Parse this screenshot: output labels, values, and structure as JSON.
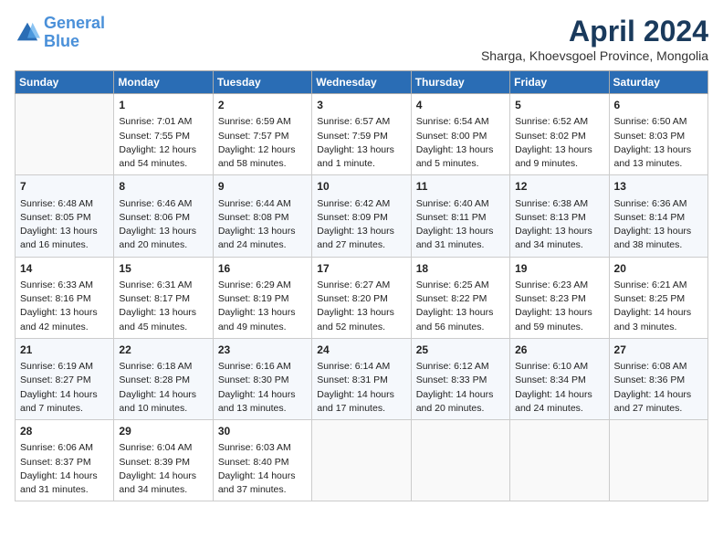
{
  "header": {
    "logo_line1": "General",
    "logo_line2": "Blue",
    "month_year": "April 2024",
    "location": "Sharga, Khoevsgoel Province, Mongolia"
  },
  "weekdays": [
    "Sunday",
    "Monday",
    "Tuesday",
    "Wednesday",
    "Thursday",
    "Friday",
    "Saturday"
  ],
  "weeks": [
    [
      {
        "day": "",
        "sunrise": "",
        "sunset": "",
        "daylight": ""
      },
      {
        "day": "1",
        "sunrise": "Sunrise: 7:01 AM",
        "sunset": "Sunset: 7:55 PM",
        "daylight": "Daylight: 12 hours and 54 minutes."
      },
      {
        "day": "2",
        "sunrise": "Sunrise: 6:59 AM",
        "sunset": "Sunset: 7:57 PM",
        "daylight": "Daylight: 12 hours and 58 minutes."
      },
      {
        "day": "3",
        "sunrise": "Sunrise: 6:57 AM",
        "sunset": "Sunset: 7:59 PM",
        "daylight": "Daylight: 13 hours and 1 minute."
      },
      {
        "day": "4",
        "sunrise": "Sunrise: 6:54 AM",
        "sunset": "Sunset: 8:00 PM",
        "daylight": "Daylight: 13 hours and 5 minutes."
      },
      {
        "day": "5",
        "sunrise": "Sunrise: 6:52 AM",
        "sunset": "Sunset: 8:02 PM",
        "daylight": "Daylight: 13 hours and 9 minutes."
      },
      {
        "day": "6",
        "sunrise": "Sunrise: 6:50 AM",
        "sunset": "Sunset: 8:03 PM",
        "daylight": "Daylight: 13 hours and 13 minutes."
      }
    ],
    [
      {
        "day": "7",
        "sunrise": "Sunrise: 6:48 AM",
        "sunset": "Sunset: 8:05 PM",
        "daylight": "Daylight: 13 hours and 16 minutes."
      },
      {
        "day": "8",
        "sunrise": "Sunrise: 6:46 AM",
        "sunset": "Sunset: 8:06 PM",
        "daylight": "Daylight: 13 hours and 20 minutes."
      },
      {
        "day": "9",
        "sunrise": "Sunrise: 6:44 AM",
        "sunset": "Sunset: 8:08 PM",
        "daylight": "Daylight: 13 hours and 24 minutes."
      },
      {
        "day": "10",
        "sunrise": "Sunrise: 6:42 AM",
        "sunset": "Sunset: 8:09 PM",
        "daylight": "Daylight: 13 hours and 27 minutes."
      },
      {
        "day": "11",
        "sunrise": "Sunrise: 6:40 AM",
        "sunset": "Sunset: 8:11 PM",
        "daylight": "Daylight: 13 hours and 31 minutes."
      },
      {
        "day": "12",
        "sunrise": "Sunrise: 6:38 AM",
        "sunset": "Sunset: 8:13 PM",
        "daylight": "Daylight: 13 hours and 34 minutes."
      },
      {
        "day": "13",
        "sunrise": "Sunrise: 6:36 AM",
        "sunset": "Sunset: 8:14 PM",
        "daylight": "Daylight: 13 hours and 38 minutes."
      }
    ],
    [
      {
        "day": "14",
        "sunrise": "Sunrise: 6:33 AM",
        "sunset": "Sunset: 8:16 PM",
        "daylight": "Daylight: 13 hours and 42 minutes."
      },
      {
        "day": "15",
        "sunrise": "Sunrise: 6:31 AM",
        "sunset": "Sunset: 8:17 PM",
        "daylight": "Daylight: 13 hours and 45 minutes."
      },
      {
        "day": "16",
        "sunrise": "Sunrise: 6:29 AM",
        "sunset": "Sunset: 8:19 PM",
        "daylight": "Daylight: 13 hours and 49 minutes."
      },
      {
        "day": "17",
        "sunrise": "Sunrise: 6:27 AM",
        "sunset": "Sunset: 8:20 PM",
        "daylight": "Daylight: 13 hours and 52 minutes."
      },
      {
        "day": "18",
        "sunrise": "Sunrise: 6:25 AM",
        "sunset": "Sunset: 8:22 PM",
        "daylight": "Daylight: 13 hours and 56 minutes."
      },
      {
        "day": "19",
        "sunrise": "Sunrise: 6:23 AM",
        "sunset": "Sunset: 8:23 PM",
        "daylight": "Daylight: 13 hours and 59 minutes."
      },
      {
        "day": "20",
        "sunrise": "Sunrise: 6:21 AM",
        "sunset": "Sunset: 8:25 PM",
        "daylight": "Daylight: 14 hours and 3 minutes."
      }
    ],
    [
      {
        "day": "21",
        "sunrise": "Sunrise: 6:19 AM",
        "sunset": "Sunset: 8:27 PM",
        "daylight": "Daylight: 14 hours and 7 minutes."
      },
      {
        "day": "22",
        "sunrise": "Sunrise: 6:18 AM",
        "sunset": "Sunset: 8:28 PM",
        "daylight": "Daylight: 14 hours and 10 minutes."
      },
      {
        "day": "23",
        "sunrise": "Sunrise: 6:16 AM",
        "sunset": "Sunset: 8:30 PM",
        "daylight": "Daylight: 14 hours and 13 minutes."
      },
      {
        "day": "24",
        "sunrise": "Sunrise: 6:14 AM",
        "sunset": "Sunset: 8:31 PM",
        "daylight": "Daylight: 14 hours and 17 minutes."
      },
      {
        "day": "25",
        "sunrise": "Sunrise: 6:12 AM",
        "sunset": "Sunset: 8:33 PM",
        "daylight": "Daylight: 14 hours and 20 minutes."
      },
      {
        "day": "26",
        "sunrise": "Sunrise: 6:10 AM",
        "sunset": "Sunset: 8:34 PM",
        "daylight": "Daylight: 14 hours and 24 minutes."
      },
      {
        "day": "27",
        "sunrise": "Sunrise: 6:08 AM",
        "sunset": "Sunset: 8:36 PM",
        "daylight": "Daylight: 14 hours and 27 minutes."
      }
    ],
    [
      {
        "day": "28",
        "sunrise": "Sunrise: 6:06 AM",
        "sunset": "Sunset: 8:37 PM",
        "daylight": "Daylight: 14 hours and 31 minutes."
      },
      {
        "day": "29",
        "sunrise": "Sunrise: 6:04 AM",
        "sunset": "Sunset: 8:39 PM",
        "daylight": "Daylight: 14 hours and 34 minutes."
      },
      {
        "day": "30",
        "sunrise": "Sunrise: 6:03 AM",
        "sunset": "Sunset: 8:40 PM",
        "daylight": "Daylight: 14 hours and 37 minutes."
      },
      {
        "day": "",
        "sunrise": "",
        "sunset": "",
        "daylight": ""
      },
      {
        "day": "",
        "sunrise": "",
        "sunset": "",
        "daylight": ""
      },
      {
        "day": "",
        "sunrise": "",
        "sunset": "",
        "daylight": ""
      },
      {
        "day": "",
        "sunrise": "",
        "sunset": "",
        "daylight": ""
      }
    ]
  ]
}
